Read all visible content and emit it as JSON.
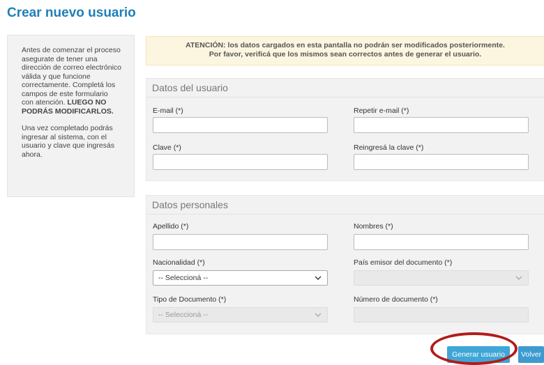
{
  "page": {
    "title": "Crear nuevo usuario"
  },
  "info": {
    "p1_text": "Antes de comenzar el proceso asegurate de tener una dirección de correo electrónico válida y que funcione correctamente. Completá los campos de este formulario con atención.",
    "p1_bold": "LUEGO NO PODRÁS MODIFICARLOS.",
    "p2": "Una vez completado podrás ingresar al sistema, con el usuario y clave que ingresás ahora."
  },
  "alert": {
    "prefix": "ATENCIÓN:",
    "line1_rest": " los datos cargados en esta pantalla no podrán ser modificados posteriormente.",
    "line2": "Por favor, verificá que los mismos sean correctos antes de generar el usuario."
  },
  "user_section": {
    "title": "Datos del usuario",
    "email_label": "E-mail (*)",
    "email_repeat_label": "Repetir e-mail (*)",
    "password_label": "Clave (*)",
    "password_repeat_label": "Reingresá la clave (*)"
  },
  "personal_section": {
    "title": "Datos personales",
    "surname_label": "Apellido (*)",
    "names_label": "Nombres (*)",
    "nationality_label": "Nacionalidad (*)",
    "nationality_value": "-- Seleccioná --",
    "issuer_country_label": "País emisor del documento (*)",
    "issuer_country_value": "",
    "doc_type_label": "Tipo de Documento (*)",
    "doc_type_value": "-- Seleccioná --",
    "doc_number_label": "Número de documento (*)"
  },
  "buttons": {
    "generate": "Generar usuario",
    "back": "Volver"
  },
  "colors": {
    "title": "#1f7fb8",
    "button": "#40a6d6",
    "alert_bg": "#fcf6e0",
    "highlight": "#b31b1b"
  }
}
